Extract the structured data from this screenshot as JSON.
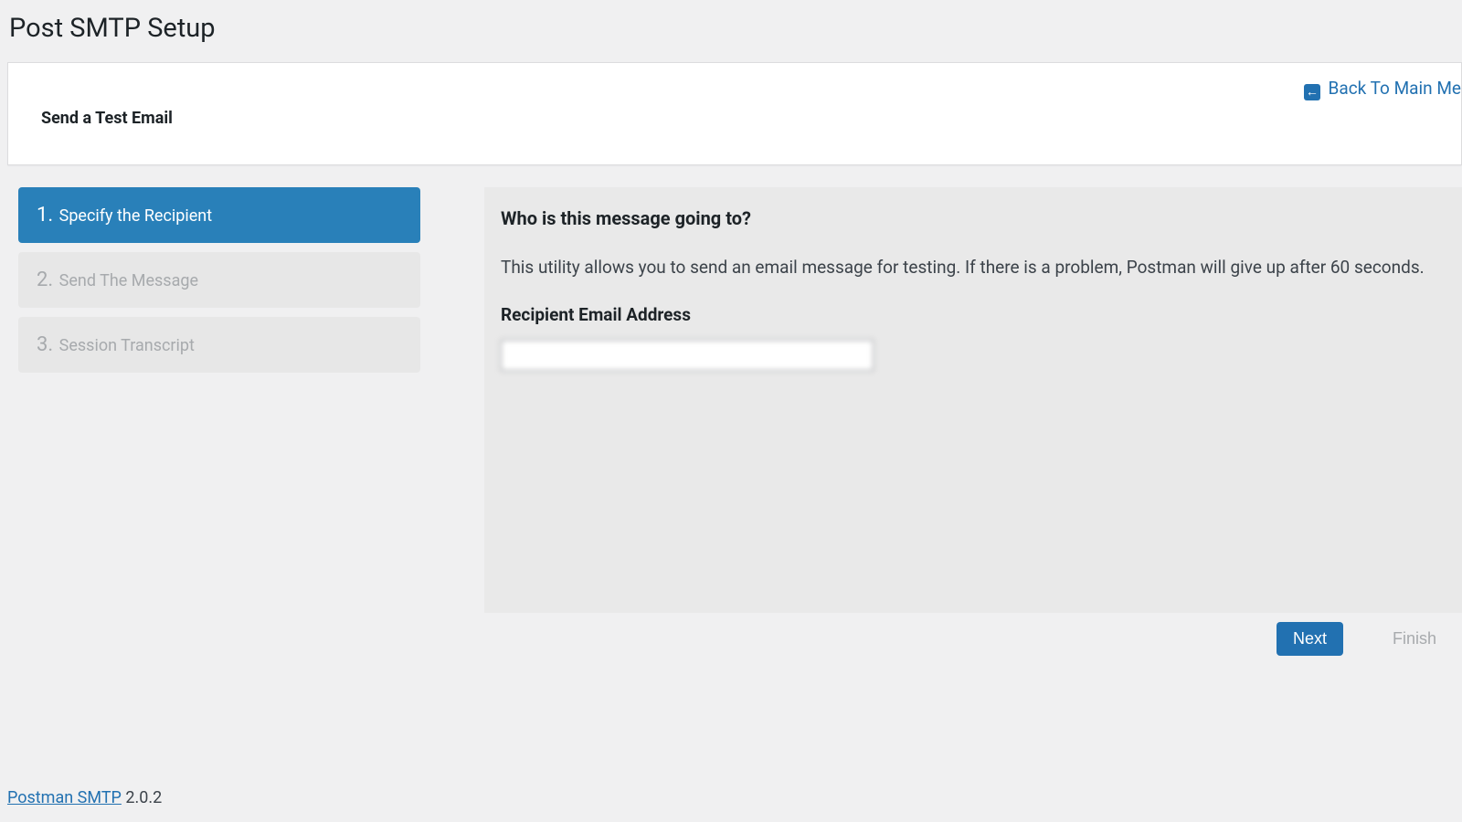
{
  "page_title": "Post SMTP Setup",
  "back_link": {
    "label": "Back To Main Me",
    "icon": "←"
  },
  "card_title": "Send a Test Email",
  "steps": [
    {
      "num": "1.",
      "label": "Specify the Recipient",
      "active": true
    },
    {
      "num": "2.",
      "label": "Send The Message",
      "active": false
    },
    {
      "num": "3.",
      "label": "Session Transcript",
      "active": false
    }
  ],
  "panel": {
    "heading": "Who is this message going to?",
    "description": "This utility allows you to send an email message for testing. If there is a problem, Postman will give up after 60 seconds.",
    "field_label": "Recipient Email Address",
    "field_value": "                          "
  },
  "buttons": {
    "next": "Next",
    "finish": "Finish"
  },
  "footer": {
    "link": "Postman SMTP",
    "version": " 2.0.2"
  }
}
